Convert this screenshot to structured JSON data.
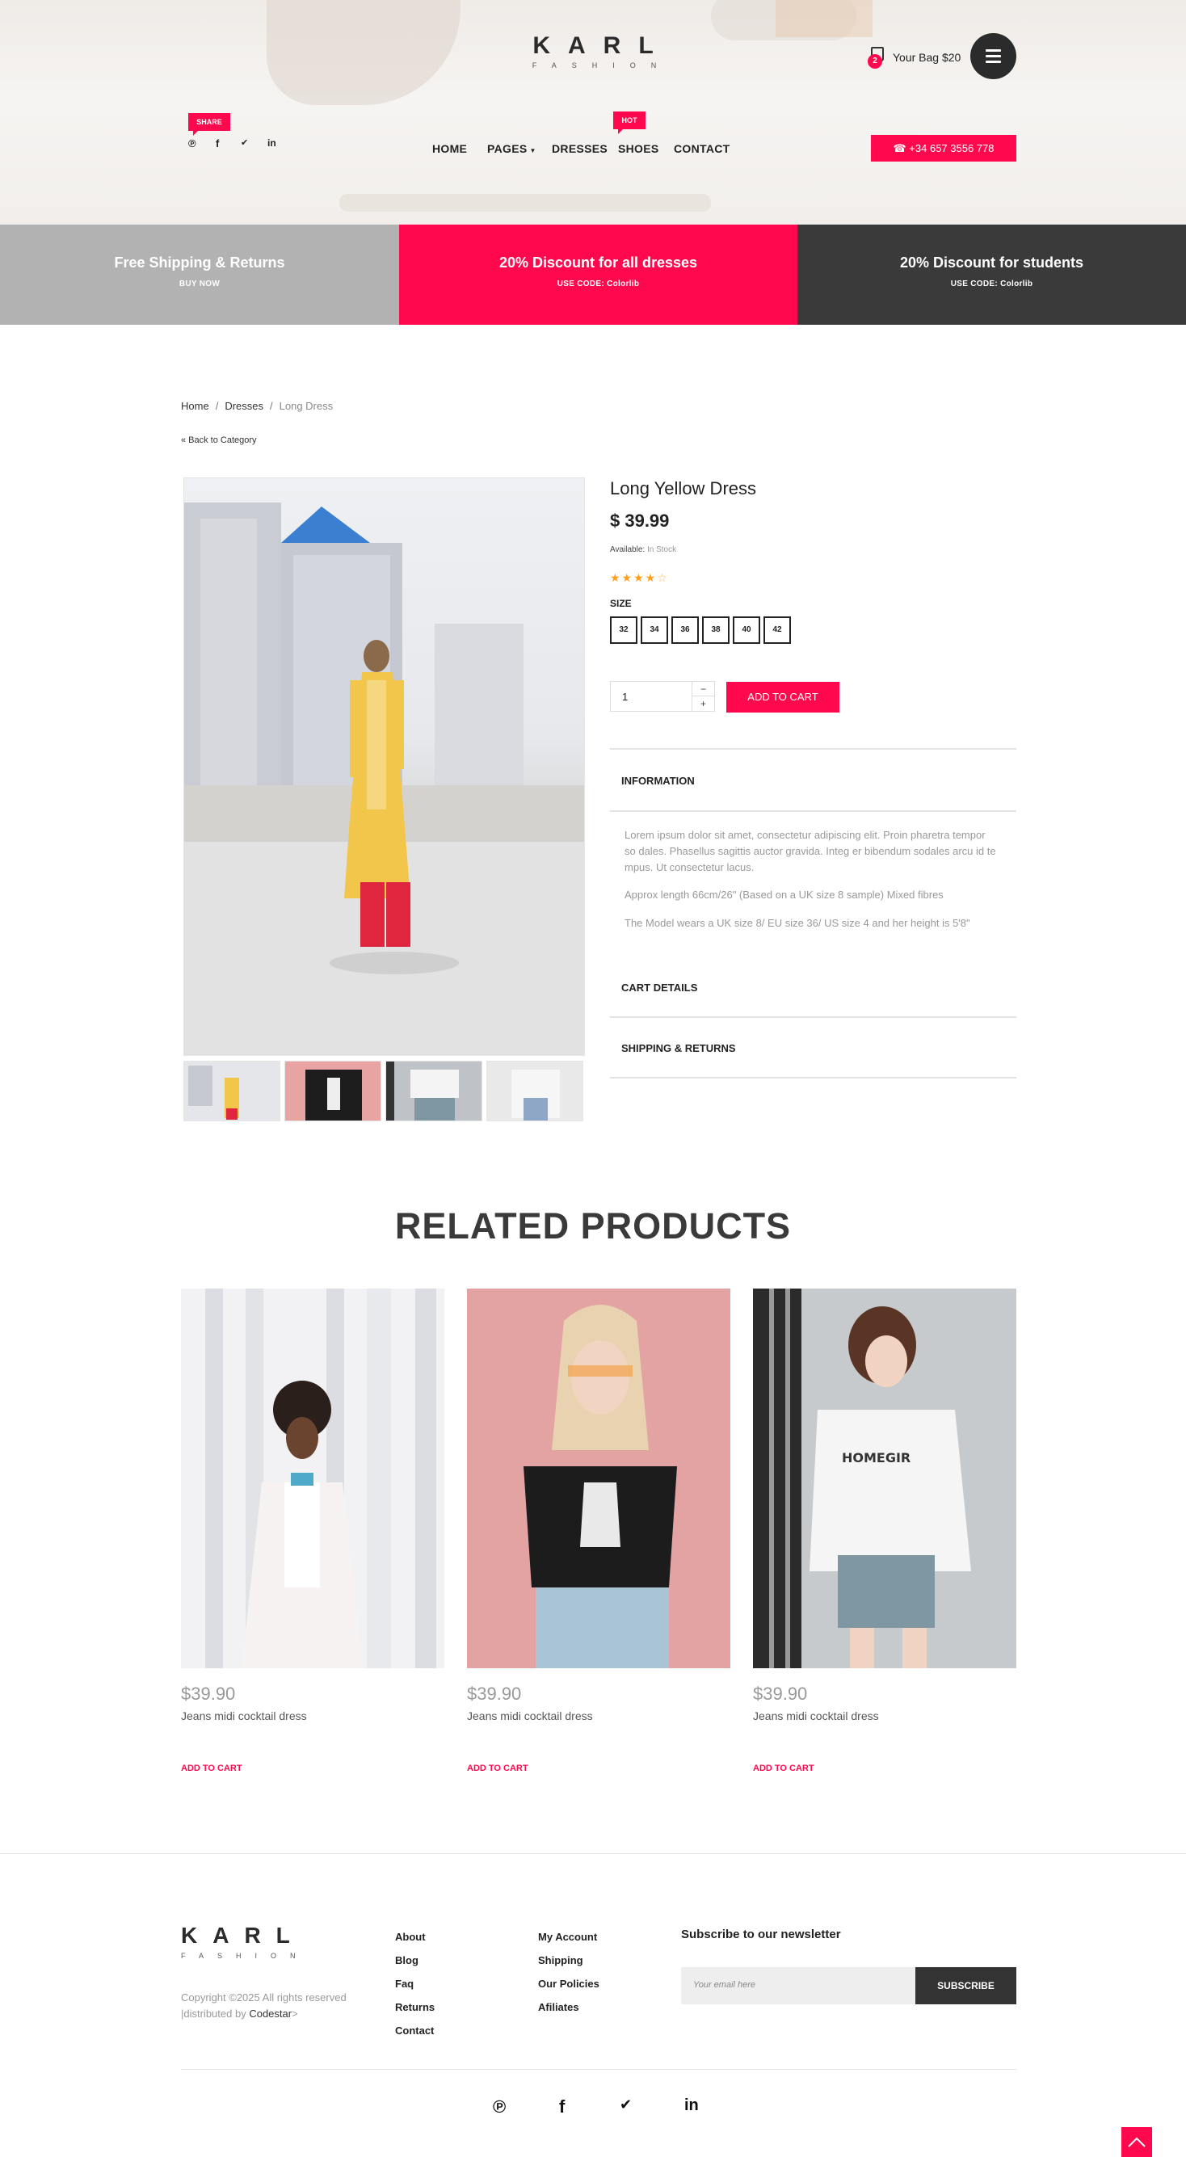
{
  "colors": {
    "accent": "#ff084e",
    "dark": "#3a3a3a",
    "grey_promo": "#b2b2b2",
    "star": "#ff9f1a"
  },
  "header": {
    "logo_main": "KARL",
    "logo_sub": "FASHION",
    "bag_count": "2",
    "bag_text": "Your Bag $20",
    "menu_icon": "hamburger-icon",
    "share_tag": "SHARE",
    "social": [
      {
        "icon": "pinterest-icon",
        "glyph": "℗"
      },
      {
        "icon": "facebook-icon",
        "glyph": "f"
      },
      {
        "icon": "twitter-icon",
        "glyph": "✔"
      },
      {
        "icon": "linkedin-icon",
        "glyph": "in"
      }
    ],
    "nav": {
      "home": "HOME",
      "pages": "PAGES",
      "dresses": "DRESSES",
      "shoes": "SHOES",
      "contact": "CONTACT"
    },
    "hot_tag": "HOT",
    "phone": "☎ +34 657 3556 778"
  },
  "promos": [
    {
      "title": "Free Shipping & Returns",
      "sub": "BUY NOW"
    },
    {
      "title": "20% Discount for all dresses",
      "sub": "USE CODE: Colorlib"
    },
    {
      "title": "20% Discount for students",
      "sub": "USE CODE: Colorlib"
    }
  ],
  "breadcrumb": {
    "home": "Home",
    "sep": "/",
    "dresses": "Dresses",
    "current": "Long Dress"
  },
  "back_link": "« Back to Category",
  "product": {
    "title": "Long Yellow Dress",
    "price": "$ 39.99",
    "available_label": "Available:",
    "available_value": "In Stock",
    "rating": 4,
    "rating_max": 5,
    "stars_on": "★★★★",
    "stars_off": "☆",
    "size_label": "SIZE",
    "sizes": [
      "32",
      "34",
      "36",
      "38",
      "40",
      "42"
    ],
    "quantity": "1",
    "qty_minus": "−",
    "qty_plus": "+",
    "add_to_cart": "ADD TO CART"
  },
  "accordion": {
    "information": "INFORMATION",
    "info_text_1": "Lorem ipsum dolor sit amet, consectetur adipiscing elit. Proin pharetra tempor so dales. Phasellus sagittis auctor gravida. Integ er bibendum sodales arcu id te mpus. Ut consectetur lacus.",
    "info_text_2": "Approx length 66cm/26\" (Based on a UK size 8 sample) Mixed fibres",
    "info_text_3": "The Model wears a UK size 8/ EU size 36/ US size 4 and her height is 5'8\"",
    "cart_details": "CART DETAILS",
    "shipping": "SHIPPING & RETURNS"
  },
  "related": {
    "title": "RELATED PRODUCTS",
    "items": [
      {
        "price": "$39.90",
        "name": "Jeans midi cocktail dress",
        "add": "ADD TO CART"
      },
      {
        "price": "$39.90",
        "name": "Jeans midi cocktail dress",
        "add": "ADD TO CART"
      },
      {
        "price": "$39.90",
        "name": "Jeans midi cocktail dress",
        "add": "ADD TO CART"
      }
    ],
    "shirt_text": "HOMEGIR"
  },
  "footer": {
    "logo_main": "KARL",
    "logo_sub": "FASHION",
    "copyright": "Copyright ©2025 All rights reserved",
    "distributed": "|distributed by",
    "distributor": "Codestar",
    "distributor_tail": ">",
    "links_col1": [
      "About",
      "Blog",
      "Faq",
      "Returns",
      "Contact"
    ],
    "links_col2": [
      "My Account",
      "Shipping",
      "Our Policies",
      "Afiliates"
    ],
    "newsletter_title": "Subscribe to our newsletter",
    "email_placeholder": "Your email here",
    "subscribe": "SUBSCRIBE",
    "social": [
      {
        "icon": "pinterest-icon",
        "glyph": "℗"
      },
      {
        "icon": "facebook-icon",
        "glyph": "f"
      },
      {
        "icon": "twitter-icon",
        "glyph": "✔"
      },
      {
        "icon": "linkedin-icon",
        "glyph": "in"
      }
    ]
  }
}
